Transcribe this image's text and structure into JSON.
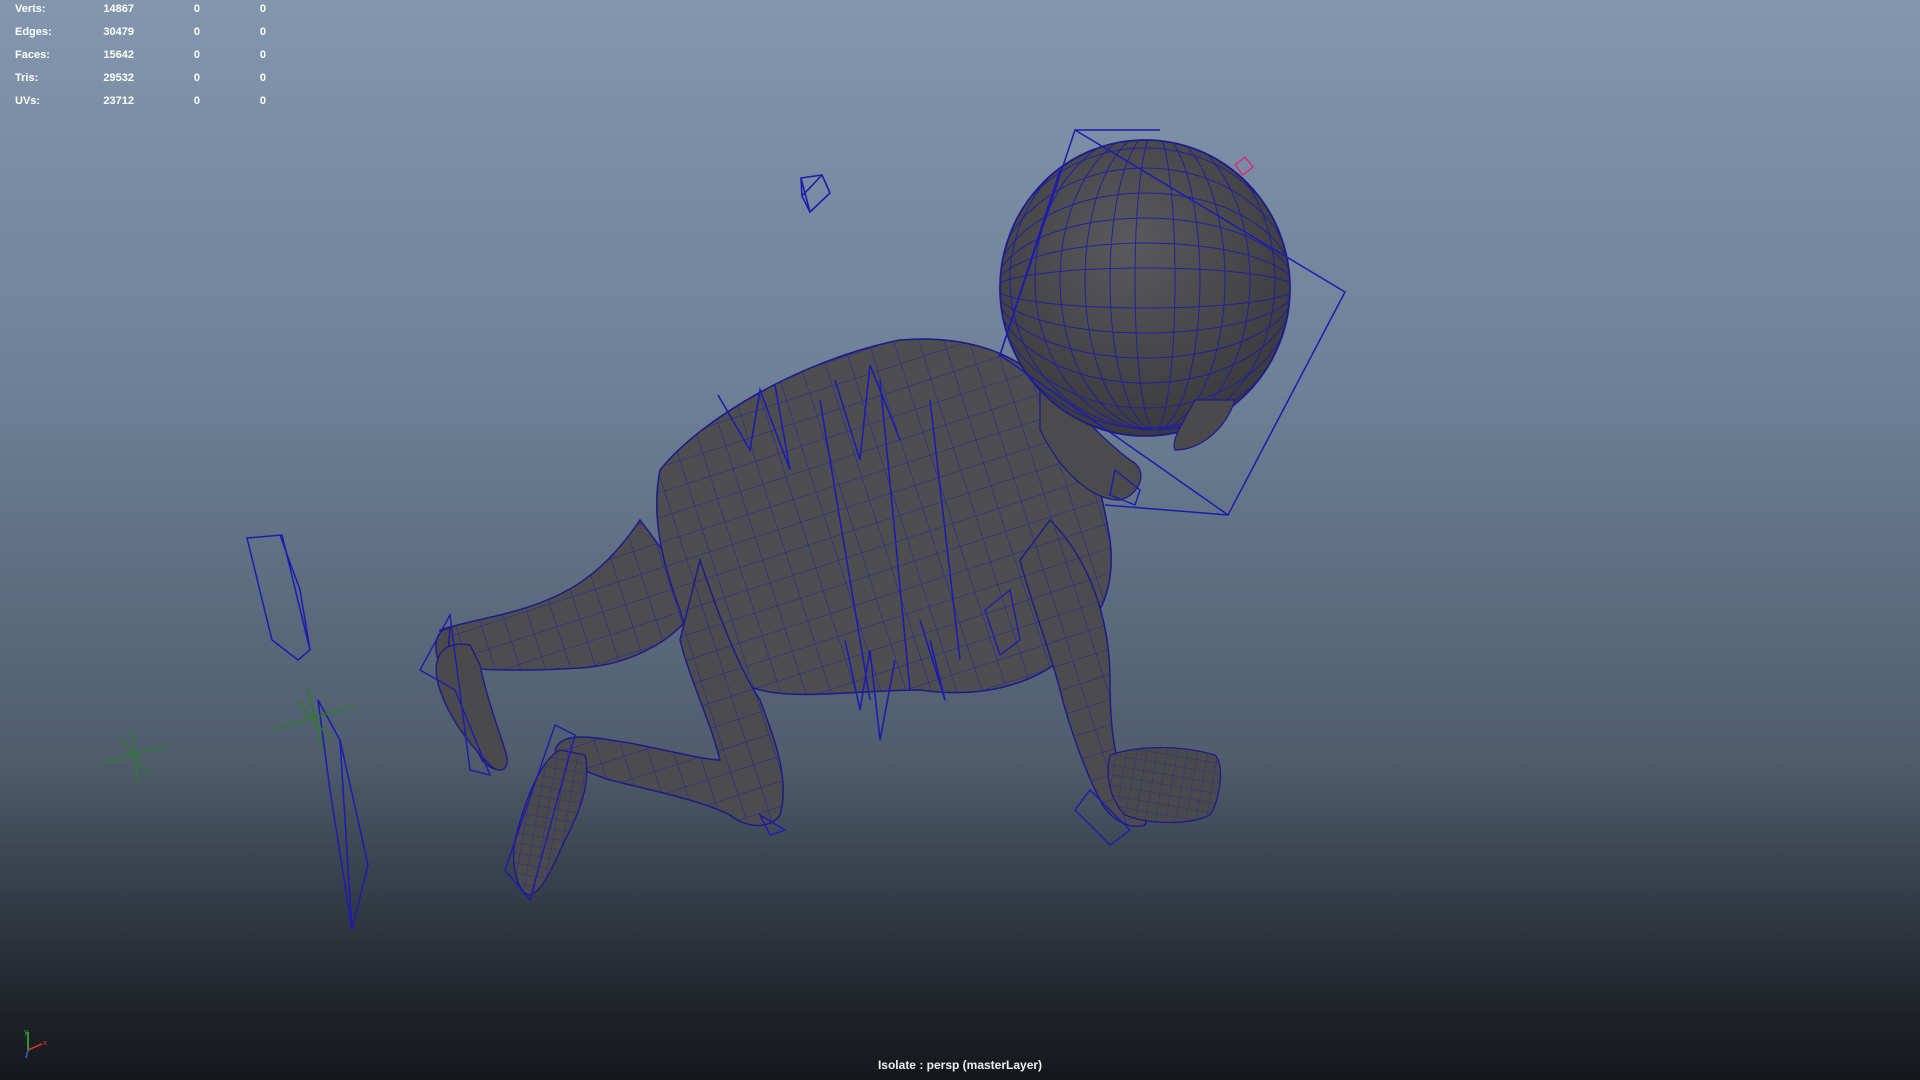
{
  "viewport": {
    "name": "Perspective viewport",
    "camera_label": "Isolate : persp (masterLayer)",
    "background_colors": {
      "top": "#8296ad",
      "middle": "#4f5d6d",
      "bottom": "#15171b"
    },
    "wireframe_color": "#1f1fa6",
    "mesh_color": "#4e4e50"
  },
  "heads_up_display": {
    "poly_count": [
      {
        "label": "Verts:",
        "total": "14867",
        "selected": "0",
        "component": "0"
      },
      {
        "label": "Edges:",
        "total": "30479",
        "selected": "0",
        "component": "0"
      },
      {
        "label": "Faces:",
        "total": "15642",
        "selected": "0",
        "component": "0"
      },
      {
        "label": "Tris:",
        "total": "29532",
        "selected": "0",
        "component": "0"
      },
      {
        "label": "UVs:",
        "total": "23712",
        "selected": "0",
        "component": "0"
      }
    ]
  },
  "scene_objects": [
    "baby-character-mesh",
    "head-control",
    "spine-controls",
    "hand-controls",
    "foot-controls",
    "camera-icon",
    "locators",
    "ik-pole-controls"
  ],
  "axis_gizmo": {
    "icon": "view-axis-icon",
    "colors": {
      "x": "#e03030",
      "y": "#30c030",
      "z": "#3060e0"
    }
  }
}
